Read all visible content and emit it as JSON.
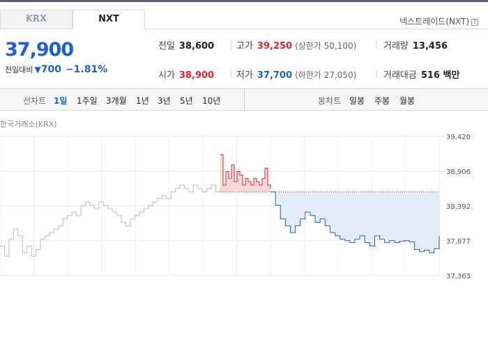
{
  "tabs": [
    {
      "label": "KRX",
      "active": false
    },
    {
      "label": "NXT",
      "active": true
    }
  ],
  "nxt_link": "넥스트레이드(NXT)",
  "price": {
    "current": "37,900",
    "change_label": "전일대비",
    "change_symbol": "▼",
    "change_value": "700",
    "change_pct": "−1.81%"
  },
  "stats": {
    "prev_close": {
      "label": "전일",
      "value": "38,600"
    },
    "high": {
      "label": "고가",
      "value": "39,250",
      "sub": "(상한가 50,100)"
    },
    "volume": {
      "label": "거래량",
      "value": "13,456"
    },
    "open": {
      "label": "시가",
      "value": "38,900"
    },
    "low": {
      "label": "저가",
      "value": "37,700",
      "sub": "(하한가 27,050)"
    },
    "trade_value": {
      "label": "거래대금",
      "value": "516 백만"
    }
  },
  "toolbar": {
    "line_label": "선차트",
    "periods": [
      "1일",
      "1주일",
      "3개월",
      "1년",
      "3년",
      "5년",
      "10년"
    ],
    "active_period": "1일",
    "candle_label": "봉차트",
    "candles": [
      "일봉",
      "주봉",
      "월봉"
    ]
  },
  "chart_title": "한국거래소(KRX)",
  "colors": {
    "up": "#e0242b",
    "down": "#1a5fd3",
    "prev": "#b9bcc2",
    "down_fill": "#e3ecf8",
    "up_fill": "#f9d8da"
  },
  "chart_data": {
    "type": "line",
    "title": "",
    "xlabel": "",
    "ylabel": "",
    "baseline": 38600,
    "ylim": [
      37363,
      39420
    ],
    "y_ticks": [
      "39,420",
      "38,906",
      "38,392",
      "37,877",
      "37,363"
    ],
    "y_tick_values": [
      39420,
      38906,
      38392,
      37877,
      37363
    ],
    "grid": true,
    "series": [
      {
        "segment": "previous-day",
        "values": [
          37800,
          37650,
          37900,
          38050,
          37950,
          37700,
          37800,
          37650,
          37750,
          37900,
          37950,
          38000,
          38050,
          38100,
          38200,
          38250,
          38300,
          38250,
          38400,
          38450,
          38400,
          38350,
          38450,
          38400,
          38350,
          38300,
          38250,
          38150,
          38100,
          38200,
          38250,
          38300,
          38350,
          38400,
          38450,
          38500,
          38550,
          38500,
          38600,
          38650,
          38700,
          38650,
          38600,
          38700,
          38650,
          38600,
          38650,
          38700,
          38600,
          38650
        ]
      },
      {
        "segment": "above-baseline",
        "values": [
          39150,
          38700,
          38900,
          38800,
          39000,
          38750,
          38900,
          38850,
          38700,
          38800,
          38750,
          38700,
          38800,
          38750,
          38700,
          38800,
          38950,
          38700,
          38650
        ]
      },
      {
        "segment": "below-baseline",
        "values": [
          38600,
          38400,
          38200,
          38100,
          38000,
          38100,
          38200,
          38300,
          38250,
          38150,
          38200,
          38100,
          38000,
          37950,
          37900,
          37880,
          37850,
          37900,
          37950,
          37850,
          37800,
          37950,
          37900,
          37850,
          37880,
          37850,
          37870,
          37880,
          37860,
          37750,
          37720,
          37740,
          37700,
          37760,
          37950
        ]
      }
    ]
  }
}
